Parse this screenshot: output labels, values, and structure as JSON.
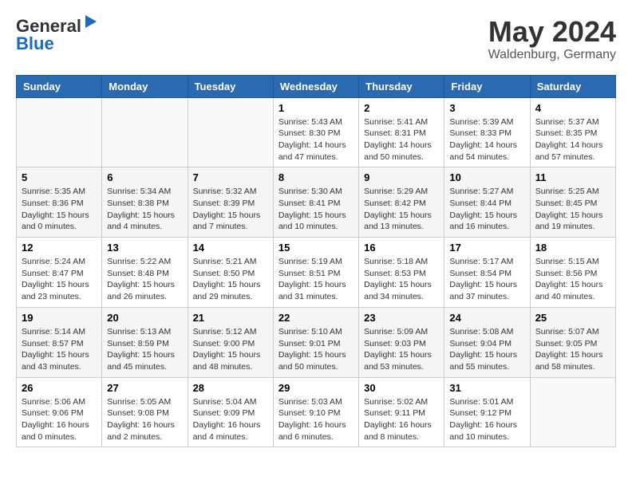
{
  "header": {
    "logo_line1": "General",
    "logo_line2": "Blue",
    "month": "May 2024",
    "location": "Waldenburg, Germany"
  },
  "columns": [
    "Sunday",
    "Monday",
    "Tuesday",
    "Wednesday",
    "Thursday",
    "Friday",
    "Saturday"
  ],
  "weeks": [
    [
      {
        "day": "",
        "info": ""
      },
      {
        "day": "",
        "info": ""
      },
      {
        "day": "",
        "info": ""
      },
      {
        "day": "1",
        "info": "Sunrise: 5:43 AM\nSunset: 8:30 PM\nDaylight: 14 hours\nand 47 minutes."
      },
      {
        "day": "2",
        "info": "Sunrise: 5:41 AM\nSunset: 8:31 PM\nDaylight: 14 hours\nand 50 minutes."
      },
      {
        "day": "3",
        "info": "Sunrise: 5:39 AM\nSunset: 8:33 PM\nDaylight: 14 hours\nand 54 minutes."
      },
      {
        "day": "4",
        "info": "Sunrise: 5:37 AM\nSunset: 8:35 PM\nDaylight: 14 hours\nand 57 minutes."
      }
    ],
    [
      {
        "day": "5",
        "info": "Sunrise: 5:35 AM\nSunset: 8:36 PM\nDaylight: 15 hours\nand 0 minutes."
      },
      {
        "day": "6",
        "info": "Sunrise: 5:34 AM\nSunset: 8:38 PM\nDaylight: 15 hours\nand 4 minutes."
      },
      {
        "day": "7",
        "info": "Sunrise: 5:32 AM\nSunset: 8:39 PM\nDaylight: 15 hours\nand 7 minutes."
      },
      {
        "day": "8",
        "info": "Sunrise: 5:30 AM\nSunset: 8:41 PM\nDaylight: 15 hours\nand 10 minutes."
      },
      {
        "day": "9",
        "info": "Sunrise: 5:29 AM\nSunset: 8:42 PM\nDaylight: 15 hours\nand 13 minutes."
      },
      {
        "day": "10",
        "info": "Sunrise: 5:27 AM\nSunset: 8:44 PM\nDaylight: 15 hours\nand 16 minutes."
      },
      {
        "day": "11",
        "info": "Sunrise: 5:25 AM\nSunset: 8:45 PM\nDaylight: 15 hours\nand 19 minutes."
      }
    ],
    [
      {
        "day": "12",
        "info": "Sunrise: 5:24 AM\nSunset: 8:47 PM\nDaylight: 15 hours\nand 23 minutes."
      },
      {
        "day": "13",
        "info": "Sunrise: 5:22 AM\nSunset: 8:48 PM\nDaylight: 15 hours\nand 26 minutes."
      },
      {
        "day": "14",
        "info": "Sunrise: 5:21 AM\nSunset: 8:50 PM\nDaylight: 15 hours\nand 29 minutes."
      },
      {
        "day": "15",
        "info": "Sunrise: 5:19 AM\nSunset: 8:51 PM\nDaylight: 15 hours\nand 31 minutes."
      },
      {
        "day": "16",
        "info": "Sunrise: 5:18 AM\nSunset: 8:53 PM\nDaylight: 15 hours\nand 34 minutes."
      },
      {
        "day": "17",
        "info": "Sunrise: 5:17 AM\nSunset: 8:54 PM\nDaylight: 15 hours\nand 37 minutes."
      },
      {
        "day": "18",
        "info": "Sunrise: 5:15 AM\nSunset: 8:56 PM\nDaylight: 15 hours\nand 40 minutes."
      }
    ],
    [
      {
        "day": "19",
        "info": "Sunrise: 5:14 AM\nSunset: 8:57 PM\nDaylight: 15 hours\nand 43 minutes."
      },
      {
        "day": "20",
        "info": "Sunrise: 5:13 AM\nSunset: 8:59 PM\nDaylight: 15 hours\nand 45 minutes."
      },
      {
        "day": "21",
        "info": "Sunrise: 5:12 AM\nSunset: 9:00 PM\nDaylight: 15 hours\nand 48 minutes."
      },
      {
        "day": "22",
        "info": "Sunrise: 5:10 AM\nSunset: 9:01 PM\nDaylight: 15 hours\nand 50 minutes."
      },
      {
        "day": "23",
        "info": "Sunrise: 5:09 AM\nSunset: 9:03 PM\nDaylight: 15 hours\nand 53 minutes."
      },
      {
        "day": "24",
        "info": "Sunrise: 5:08 AM\nSunset: 9:04 PM\nDaylight: 15 hours\nand 55 minutes."
      },
      {
        "day": "25",
        "info": "Sunrise: 5:07 AM\nSunset: 9:05 PM\nDaylight: 15 hours\nand 58 minutes."
      }
    ],
    [
      {
        "day": "26",
        "info": "Sunrise: 5:06 AM\nSunset: 9:06 PM\nDaylight: 16 hours\nand 0 minutes."
      },
      {
        "day": "27",
        "info": "Sunrise: 5:05 AM\nSunset: 9:08 PM\nDaylight: 16 hours\nand 2 minutes."
      },
      {
        "day": "28",
        "info": "Sunrise: 5:04 AM\nSunset: 9:09 PM\nDaylight: 16 hours\nand 4 minutes."
      },
      {
        "day": "29",
        "info": "Sunrise: 5:03 AM\nSunset: 9:10 PM\nDaylight: 16 hours\nand 6 minutes."
      },
      {
        "day": "30",
        "info": "Sunrise: 5:02 AM\nSunset: 9:11 PM\nDaylight: 16 hours\nand 8 minutes."
      },
      {
        "day": "31",
        "info": "Sunrise: 5:01 AM\nSunset: 9:12 PM\nDaylight: 16 hours\nand 10 minutes."
      },
      {
        "day": "",
        "info": ""
      }
    ]
  ]
}
